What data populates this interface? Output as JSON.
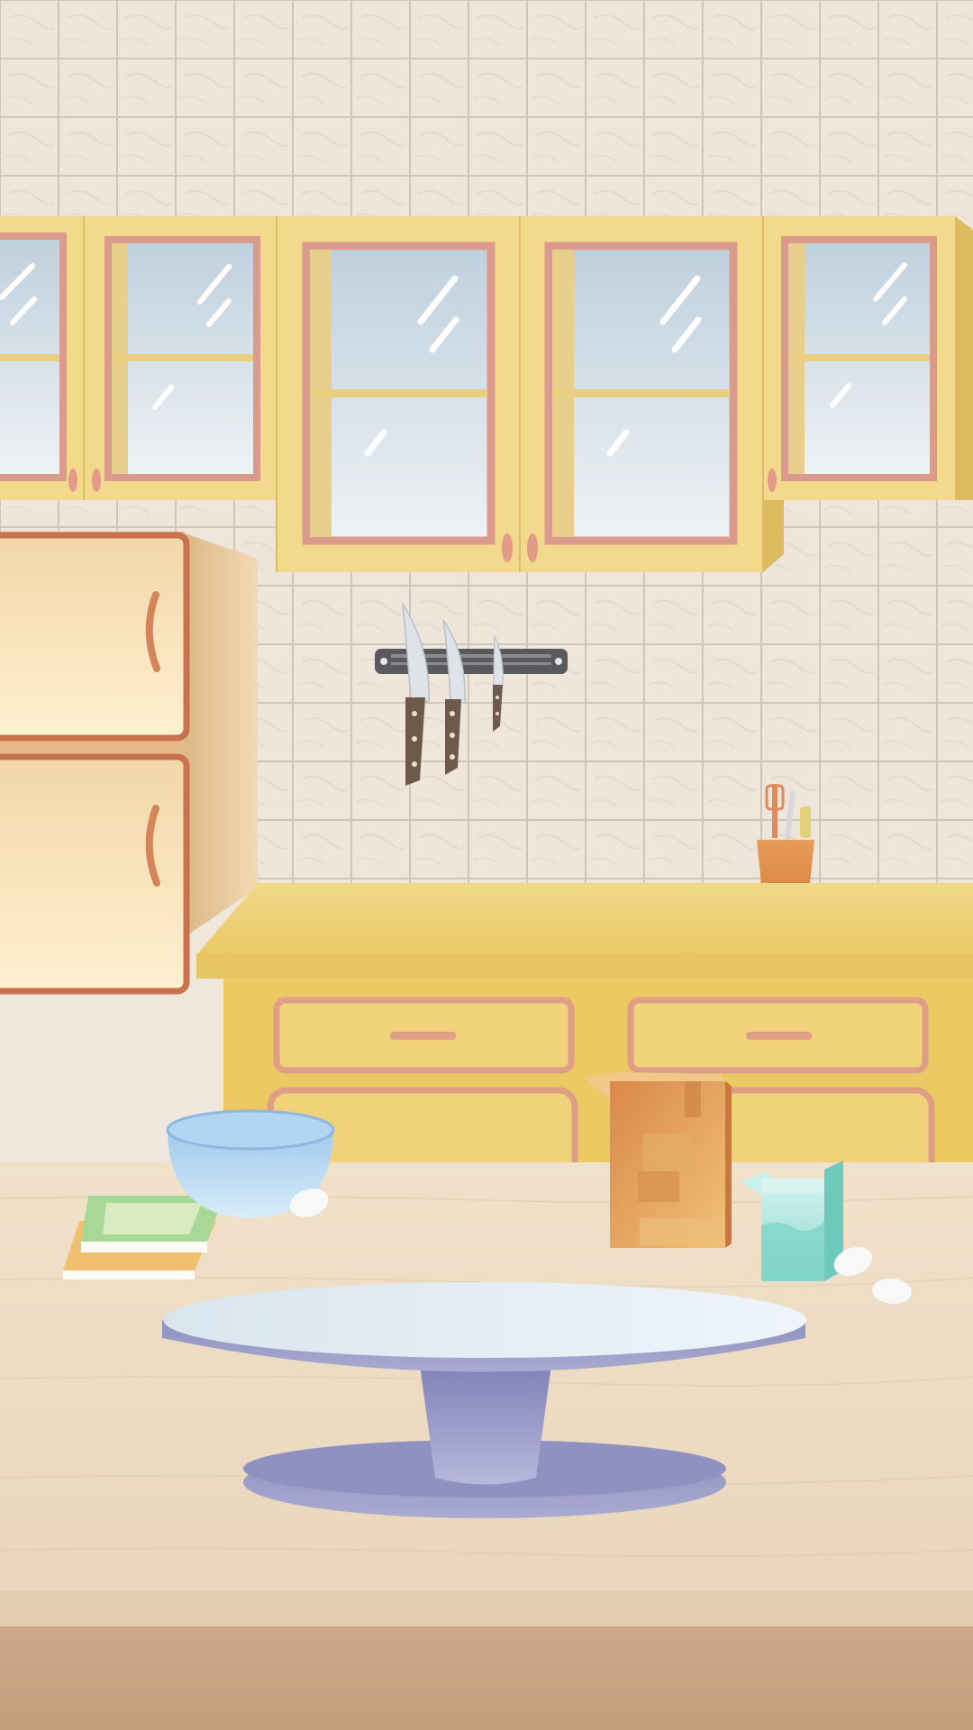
{
  "scene": {
    "name": "kitchen-cake-decorating-scene",
    "colors": {
      "wall_tile": "#eee6da",
      "tile_grout": "#cfc6ba",
      "cabinet_yellow": "#f2d98a",
      "cabinet_trim_pink": "#d99a8c",
      "glass_blue": "#dfe7ee",
      "fridge_cream": "#f5dcb2",
      "fridge_trim": "#c8734d",
      "counter_top": "#efd27a",
      "drawer_yellow": "#ecc962",
      "table_wood": "#eedcc4",
      "floor_wood": "#c9a584",
      "turntable_top": "#dfeaf2",
      "turntable_base": "#9a9cc6",
      "bowl_blue": "#bcdcf2",
      "milk_carton_teal": "#9fe0d6",
      "cutting_board": "#e0a45f"
    },
    "icons": [
      "knife-rack",
      "chef-knife",
      "utensil-holder",
      "mixing-bowl",
      "egg",
      "cookbook-stack",
      "cutting-board",
      "milk-carton",
      "cake-turntable",
      "refrigerator"
    ]
  }
}
